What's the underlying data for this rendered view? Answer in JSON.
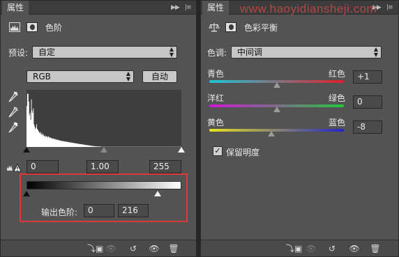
{
  "watermark": "www.haoyidiansheji.com",
  "levels": {
    "tab_label": "属性",
    "title": "色阶",
    "preset_label": "预设:",
    "preset_value": "自定",
    "channel": "RGB",
    "auto_label": "自动",
    "input_black": "0",
    "input_gamma": "1.00",
    "input_white": "255",
    "output_label": "输出色阶:",
    "output_black": "0",
    "output_white": "216",
    "output_black_value": 0,
    "output_white_value": 216
  },
  "color_balance": {
    "tab_label": "属性",
    "title": "色彩平衡",
    "tone_label": "色调:",
    "tone_value": "中间调",
    "sliders": [
      {
        "left": "青色",
        "right": "红色",
        "value": "+1",
        "color_left": "#1ec6d6",
        "color_right": "#e0202a",
        "num": 1
      },
      {
        "left": "洋红",
        "right": "绿色",
        "value": "0",
        "color_left": "#d214d8",
        "color_right": "#21c83a",
        "num": 0
      },
      {
        "left": "黄色",
        "right": "蓝色",
        "value": "-8",
        "color_left": "#e8e21c",
        "color_right": "#2424c8",
        "num": -8
      }
    ],
    "preserve_label": "保留明度",
    "preserve_checked": true
  },
  "histogram": [
    180,
    235,
    235,
    200,
    140,
    150,
    120,
    210,
    160,
    150,
    170,
    100,
    90,
    80,
    85,
    100,
    80,
    75,
    70,
    65,
    60,
    66,
    55,
    60,
    52,
    58,
    50,
    47,
    50,
    44,
    48,
    46,
    42,
    47,
    44,
    40,
    43,
    38,
    40,
    36,
    38,
    35,
    37,
    33,
    35,
    31,
    33,
    30,
    32,
    29,
    30,
    27,
    28,
    26,
    27,
    25,
    26,
    24,
    25,
    23,
    24,
    22,
    23,
    21,
    22,
    20,
    21,
    19,
    20,
    18,
    19,
    17,
    18,
    16,
    17,
    15,
    16,
    14,
    15,
    13,
    14,
    12,
    13,
    12,
    12,
    11,
    11,
    10,
    10,
    9,
    9,
    8,
    8,
    8,
    7,
    7,
    6,
    6,
    5,
    5,
    5,
    4,
    4,
    4,
    3,
    3,
    3,
    2,
    2,
    2,
    2,
    2,
    2,
    1,
    1,
    1,
    1,
    1,
    1,
    1,
    1,
    1,
    1,
    1,
    1,
    1,
    1,
    1,
    1,
    1,
    1,
    1,
    1,
    1,
    1,
    1,
    1,
    1,
    1,
    1,
    1,
    1,
    1,
    1,
    1,
    1,
    1,
    1,
    1,
    1,
    1,
    1,
    1,
    1,
    1,
    1,
    1,
    1,
    1,
    1,
    1,
    1,
    1,
    1,
    1,
    1,
    1,
    1,
    1,
    1,
    1,
    1,
    1,
    1,
    1,
    1,
    1,
    1,
    1,
    1,
    1,
    1,
    1,
    1,
    1,
    1,
    1,
    1,
    1,
    1,
    1,
    1,
    1,
    1,
    1,
    1,
    1,
    1,
    1,
    1,
    1,
    1,
    1,
    1,
    1,
    1,
    1,
    1,
    1,
    1,
    1,
    1,
    1,
    1,
    1,
    1,
    1,
    1,
    1,
    1,
    1,
    1,
    1,
    1,
    1,
    1,
    1,
    1,
    1,
    1,
    1,
    1,
    1,
    1,
    1,
    1
  ]
}
